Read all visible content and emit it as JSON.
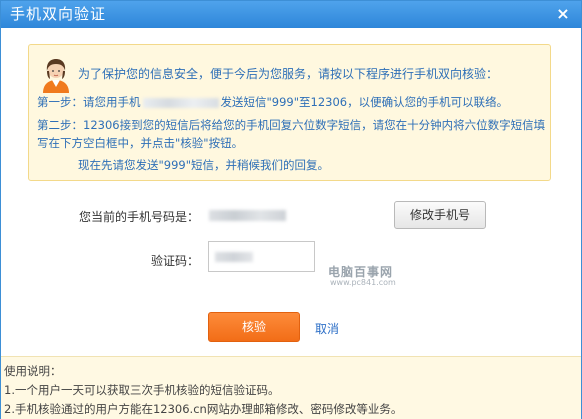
{
  "dialog": {
    "title": "手机双向验证",
    "close_label": "×"
  },
  "notice": {
    "avatar_icon": "customer-service-avatar-icon",
    "intro": "为了保护您的信息安全，便于今后为您服务，请按以下程序进行手机双向核验：",
    "step1_prefix": "第一步：请您用手机",
    "step1_suffix": "发送短信\"999\"至12306，以便确认您的手机可以联络。",
    "step2": "第二步：12306接到您的短信后将给您的手机回复六位数字短信，请您在十分钟内将六位数字短信填写在下方空白框中，并点击\"核验\"按钮。",
    "hint": "现在先请您发送\"999\"短信，并稍候我们的回复。"
  },
  "form": {
    "phone_label": "您当前的手机号码是：",
    "change_phone_label": "修改手机号",
    "code_label": "验证码：",
    "verify_label": "核验",
    "cancel_label": "取消"
  },
  "watermark": {
    "main": "电脑百事网",
    "url": "www.pc841.com"
  },
  "footer": {
    "heading": "使用说明：",
    "lines": [
      "1.一个用户一天可以获取三次手机核验的短信验证码。",
      "2.手机核验通过的用户方能在12306.cn网站办理邮箱修改、密码修改等业务。"
    ]
  },
  "colors": {
    "title_bar": "#3391e0",
    "notice_background": "#fff8df",
    "notice_text": "#2e6fb7",
    "verify_button": "#f57a22",
    "cancel_link": "#2d6fc7"
  }
}
